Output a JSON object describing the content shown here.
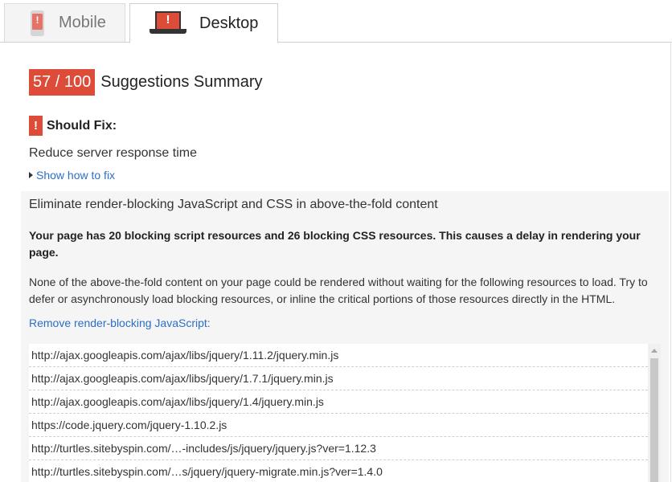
{
  "tabs": {
    "mobile": {
      "label": "Mobile",
      "icon": "mobile-phone-icon"
    },
    "desktop": {
      "label": "Desktop",
      "icon": "laptop-icon",
      "active": true
    }
  },
  "score": {
    "value": "57 / 100",
    "title": "Suggestions Summary",
    "color": "#dd4b39"
  },
  "should_fix": {
    "badge": "!",
    "label": "Should Fix:"
  },
  "items": [
    {
      "title": "Reduce server response time",
      "show_fix": "Show how to fix"
    }
  ],
  "expanded": {
    "title": "Eliminate render-blocking JavaScript and CSS in above-the-fold content",
    "bold": "Your page has 20 blocking script resources and 26 blocking CSS resources. This causes a delay in rendering your page.",
    "description": "None of the above-the-fold content on your page could be rendered without waiting for the following resources to load. Try to defer or asynchronously load blocking resources, or inline the critical portions of those resources directly in the HTML.",
    "link": "Remove render-blocking JavaScript:",
    "urls": [
      "http://ajax.googleapis.com/ajax/libs/jquery/1.11.2/jquery.min.js",
      "http://ajax.googleapis.com/ajax/libs/jquery/1.7.1/jquery.min.js",
      "http://ajax.googleapis.com/ajax/libs/jquery/1.4/jquery.min.js",
      "https://code.jquery.com/jquery-1.10.2.js",
      "http://turtles.sitebyspin.com/…-includes/js/jquery/jquery.js?ver=1.12.3",
      "http://turtles.sitebyspin.com/…s/jquery/jquery-migrate.min.js?ver=1.4.0"
    ]
  },
  "colors": {
    "accent_red": "#dd4b39",
    "link_blue": "#2a6fc7"
  }
}
